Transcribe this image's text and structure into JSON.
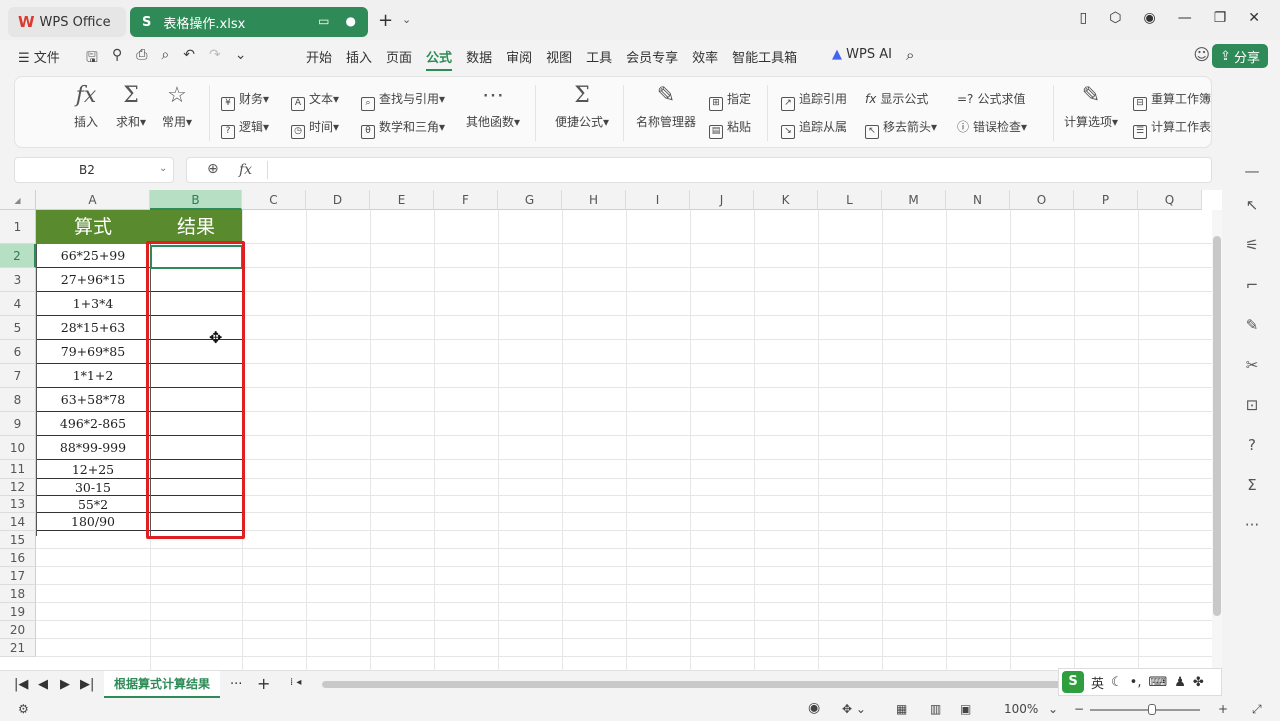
{
  "titlebar": {
    "app_tab": "WPS Office",
    "file_tab": "表格操作.xlsx",
    "file_tab_icon": "S"
  },
  "menubar": {
    "file_menu": "文件",
    "tabs": [
      "开始",
      "插入",
      "页面",
      "公式",
      "数据",
      "审阅",
      "视图",
      "工具",
      "会员专享",
      "效率",
      "智能工具箱"
    ],
    "active_tab": "公式",
    "wps_ai": "WPS AI",
    "share": "分享"
  },
  "ribbon": {
    "insert_fn": "插入",
    "sum": "求和",
    "common": "常用",
    "finance": "财务",
    "text": "文本",
    "lookup": "查找与引用",
    "logic": "逻辑",
    "time": "时间",
    "math": "数学和三角",
    "other_fn": "其他函数",
    "quick_formula": "便捷公式",
    "name_manager": "名称管理器",
    "assign": "指定",
    "paste": "粘贴",
    "trace_precedents": "追踪引用",
    "trace_dependents": "追踪从属",
    "show_formulas": "显示公式",
    "remove_arrows": "移去箭头",
    "evaluate": "公式求值",
    "error_check": "错误检查",
    "calc_options": "计算选项",
    "recalc_workbook": "重算工作簿",
    "calc_sheet": "计算工作表"
  },
  "formula_bar": {
    "name_box": "B2",
    "fx": "fx",
    "content": ""
  },
  "sheet": {
    "columns": [
      "A",
      "B",
      "C",
      "D",
      "E",
      "F",
      "G",
      "H",
      "I",
      "J",
      "K",
      "L",
      "M",
      "N",
      "O",
      "P",
      "Q"
    ],
    "rows": [
      "1",
      "2",
      "3",
      "4",
      "5",
      "6",
      "7",
      "8",
      "9",
      "10",
      "11",
      "12",
      "13",
      "14",
      "15",
      "16",
      "17",
      "18",
      "19",
      "20",
      "21"
    ],
    "header_a": "算式",
    "header_b": "结果",
    "expressions": [
      "66*25+99",
      "27+96*15",
      "1+3*4",
      "28*15+63",
      "79+69*85",
      "1*1+2",
      "63+58*78",
      "496*2-865",
      "88*99-999",
      "12+25",
      "30-15",
      "55*2",
      "180/90"
    ],
    "selected_cell": "B2",
    "accent": "#2e8b57",
    "header_fill": "#5a8a2e",
    "highlight_color": "#e02020"
  },
  "tabbar": {
    "sheet_name": "根据算式计算结果",
    "more": "···",
    "add": "+"
  },
  "ime": {
    "logo": "S",
    "lang": "英"
  },
  "statusbar": {
    "zoom": "100%"
  }
}
